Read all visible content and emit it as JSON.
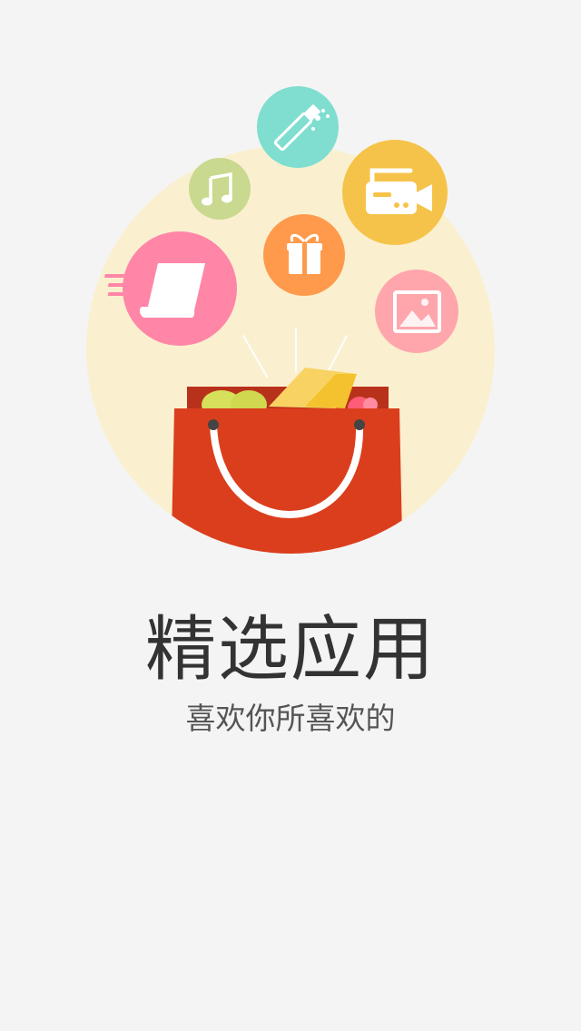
{
  "splash": {
    "title": "精选应用",
    "subtitle": "喜欢你所喜欢的"
  },
  "colors": {
    "background": "#f4f4f4",
    "circle": "#faf0d0",
    "bag": "#db3e1d",
    "magic": "#7fded0",
    "music": "#c9d98f",
    "video": "#f6c34a",
    "gift": "#ff9a4c",
    "document": "#ff86a7",
    "image": "#ffa6ad"
  },
  "icons": [
    "magic-wand-icon",
    "music-note-icon",
    "video-camera-icon",
    "gift-icon",
    "document-icon",
    "image-icon",
    "shopping-bag-icon"
  ]
}
